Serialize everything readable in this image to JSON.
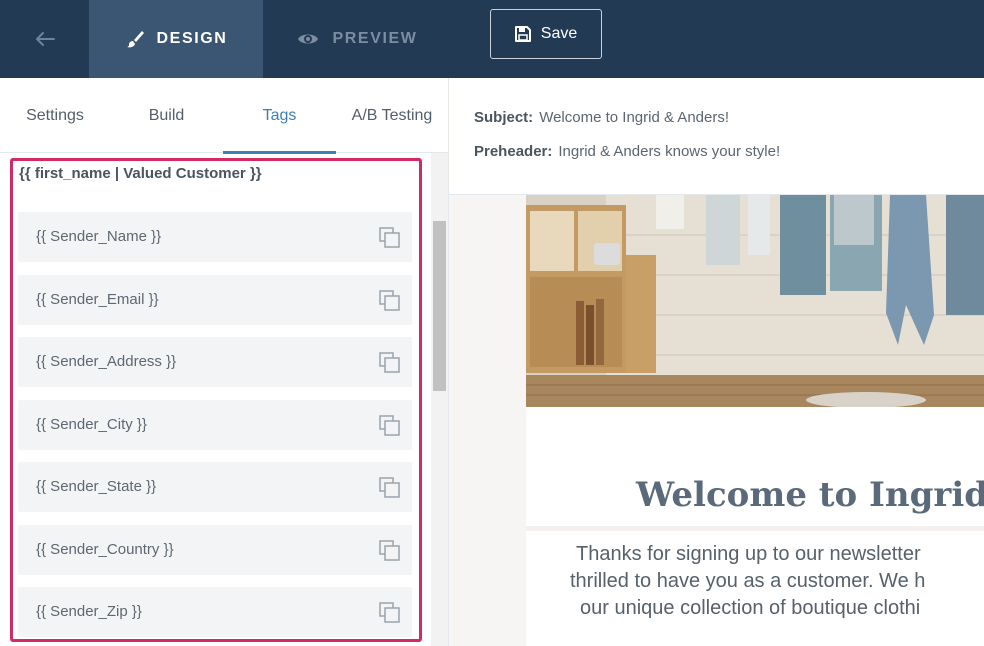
{
  "topbar": {
    "design_label": "DESIGN",
    "preview_label": "PREVIEW",
    "save_label": "Save"
  },
  "subtabs": [
    "Settings",
    "Build",
    "Tags",
    "A/B Testing"
  ],
  "active_subtab": "Tags",
  "tags": {
    "first_tag": "{{ first_name | Valued Customer }}",
    "items": [
      "{{ Sender_Name }}",
      "{{ Sender_Email }}",
      "{{ Sender_Address }}",
      "{{ Sender_City }}",
      "{{ Sender_State }}",
      "{{ Sender_Country }}",
      "{{ Sender_Zip }}"
    ]
  },
  "email": {
    "subject_label": "Subject:",
    "subject": "Welcome to Ingrid & Anders!",
    "preheader_label": "Preheader:",
    "preheader": "Ingrid & Anders knows your style!",
    "title": "Welcome to Ingrid &",
    "body_lines": [
      "Thanks for signing up to our newsletter",
      "thrilled to have you as a customer. We h",
      "our unique collection of boutique clothi"
    ]
  },
  "colors": {
    "topbar_bg": "#233a55",
    "active_tab_bg": "#3a5673",
    "accent": "#3b7fb6",
    "highlight": "#d22a63"
  },
  "icons": {
    "back": "arrow-left-icon",
    "design": "brush-icon",
    "preview": "eye-icon",
    "save": "floppy-disk-icon",
    "copy": "copy-icon"
  }
}
